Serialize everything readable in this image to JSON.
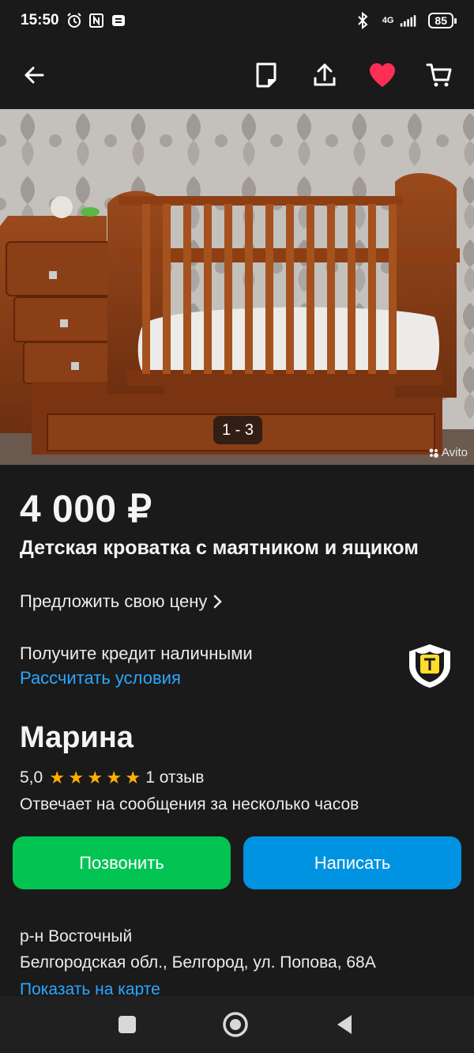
{
  "status_bar": {
    "time": "15:50",
    "network": "4G",
    "battery": "85"
  },
  "toolbar": {
    "icons": [
      "arrow-left-icon",
      "note-icon",
      "share-icon",
      "heart-icon",
      "cart-icon"
    ],
    "favorite_color": "#ff2e55"
  },
  "gallery": {
    "counter": "1 - 3",
    "watermark": "Avito"
  },
  "listing": {
    "price": "4 000 ₽",
    "title": "Детская кроватка с маятником и ящиком",
    "offer_price": "Предложить свою цену"
  },
  "credit": {
    "text": "Получите кредит наличными",
    "link": "Рассчитать условия"
  },
  "seller": {
    "name": "Марина",
    "rating": "5,0",
    "stars": 5,
    "reviews": "1 отзыв",
    "response": "Отвечает на сообщения за несколько часов"
  },
  "actions": {
    "call": "Позвонить",
    "write": "Написать",
    "call_color": "#02c453",
    "write_color": "#0093e1"
  },
  "location": {
    "district": "р-н Восточный",
    "address": "Белгородская обл., Белгород, ул. Попова, 68А",
    "map_link": "Показать на карте"
  },
  "colors": {
    "background": "#1a1a1a",
    "link": "#2aa7ff",
    "star": "#ffb000"
  }
}
